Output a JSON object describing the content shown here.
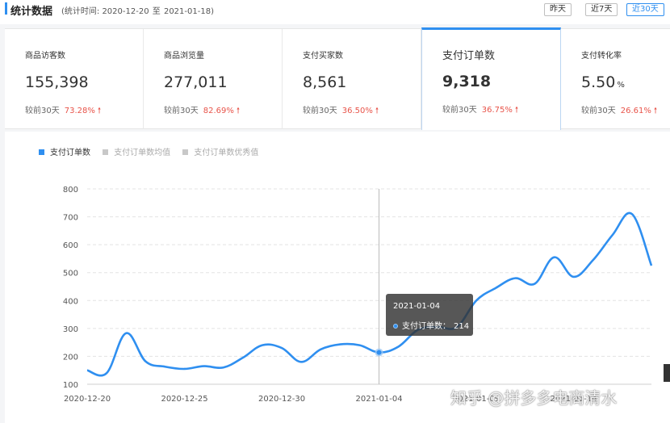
{
  "header": {
    "title": "统计数据",
    "range_prefix": "(统计时间: 2020-12-20",
    "range_sep": "至",
    "range_end": "2021-01-18)",
    "buttons": [
      "昨天",
      "近7天",
      "近30天"
    ],
    "active_button": 2
  },
  "cards": [
    {
      "label": "商品访客数",
      "value": "155,398",
      "unit": "",
      "compare": "较前30天",
      "pct": "73.28%",
      "arrow": "🠕"
    },
    {
      "label": "商品浏览量",
      "value": "277,011",
      "unit": "",
      "compare": "较前30天",
      "pct": "82.69%",
      "arrow": "🠕"
    },
    {
      "label": "支付买家数",
      "value": "8,561",
      "unit": "",
      "compare": "较前30天",
      "pct": "36.50%",
      "arrow": "🠕"
    },
    {
      "label": "支付订单数",
      "value": "9,318",
      "unit": "",
      "compare": "较前30天",
      "pct": "36.75%",
      "arrow": "🠕"
    },
    {
      "label": "支付转化率",
      "value": "5.50",
      "unit": "%",
      "compare": "较前30天",
      "pct": "26.61%",
      "arrow": "🠕"
    }
  ],
  "active_card": 3,
  "legend": [
    {
      "label": "支付订单数",
      "color": "#2f8ff0",
      "on": true
    },
    {
      "label": "支付订单数均值",
      "color": "#c8c8c8",
      "on": false
    },
    {
      "label": "支付订单数优秀值",
      "color": "#c8c8c8",
      "on": false
    }
  ],
  "tooltip": {
    "date": "2021-01-04",
    "series": "支付订单数：",
    "value": "214"
  },
  "watermark": "知乎 @拼多多电商清水",
  "chart_data": {
    "type": "line",
    "y_ticks": [
      "100",
      "200",
      "300",
      "400",
      "500",
      "600",
      "700",
      "800"
    ],
    "ylim": [
      100,
      800
    ],
    "x_tick_labels": [
      "2020-12-20",
      "2020-12-25",
      "2020-12-30",
      "2021-01-04",
      "2021-01-09",
      "2021-01-14"
    ],
    "grid": true,
    "line_color": "#2f8ff0",
    "highlight_index": 15,
    "series": [
      {
        "name": "支付订单数",
        "x": [
          "2020-12-20",
          "2020-12-21",
          "2020-12-22",
          "2020-12-23",
          "2020-12-24",
          "2020-12-25",
          "2020-12-26",
          "2020-12-27",
          "2020-12-28",
          "2020-12-29",
          "2020-12-30",
          "2020-12-31",
          "2021-01-01",
          "2021-01-02",
          "2021-01-03",
          "2021-01-04",
          "2021-01-05",
          "2021-01-06",
          "2021-01-07",
          "2021-01-08",
          "2021-01-09",
          "2021-01-10",
          "2021-01-11",
          "2021-01-12",
          "2021-01-13",
          "2021-01-14",
          "2021-01-15",
          "2021-01-16",
          "2021-01-17",
          "2021-01-18"
        ],
        "values": [
          150,
          140,
          283,
          182,
          163,
          155,
          165,
          160,
          195,
          240,
          230,
          180,
          225,
          243,
          240,
          214,
          235,
          295,
          305,
          305,
          400,
          445,
          480,
          460,
          555,
          485,
          545,
          635,
          710,
          525
        ]
      }
    ]
  }
}
